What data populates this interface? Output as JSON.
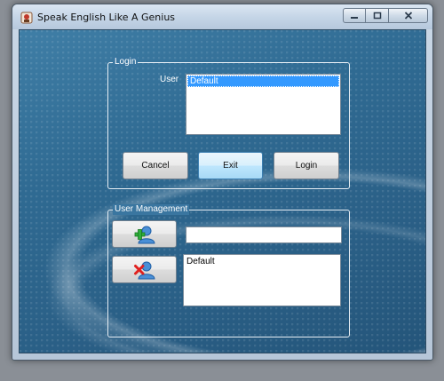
{
  "window": {
    "title": "Speak English Like A Genius",
    "app_icon": "app-badge-icon",
    "caption_buttons": {
      "minimize_icon": "minimize-icon",
      "maximize_icon": "maximize-icon",
      "close_icon": "close-icon"
    }
  },
  "login": {
    "group_title": "Login",
    "user_label": "User",
    "users": [
      "Default"
    ],
    "selected_user": "Default",
    "buttons": {
      "cancel": "Cancel",
      "exit": "Exit",
      "login": "Login"
    }
  },
  "user_management": {
    "group_title": "User Management",
    "new_user_value": "",
    "add_icon": "add-user-icon",
    "remove_icon": "remove-user-icon",
    "users": [
      "Default"
    ]
  },
  "colors": {
    "accent_selection": "#3399ff",
    "client_background": "#2f6a92",
    "group_border": "#e9f0f6"
  }
}
